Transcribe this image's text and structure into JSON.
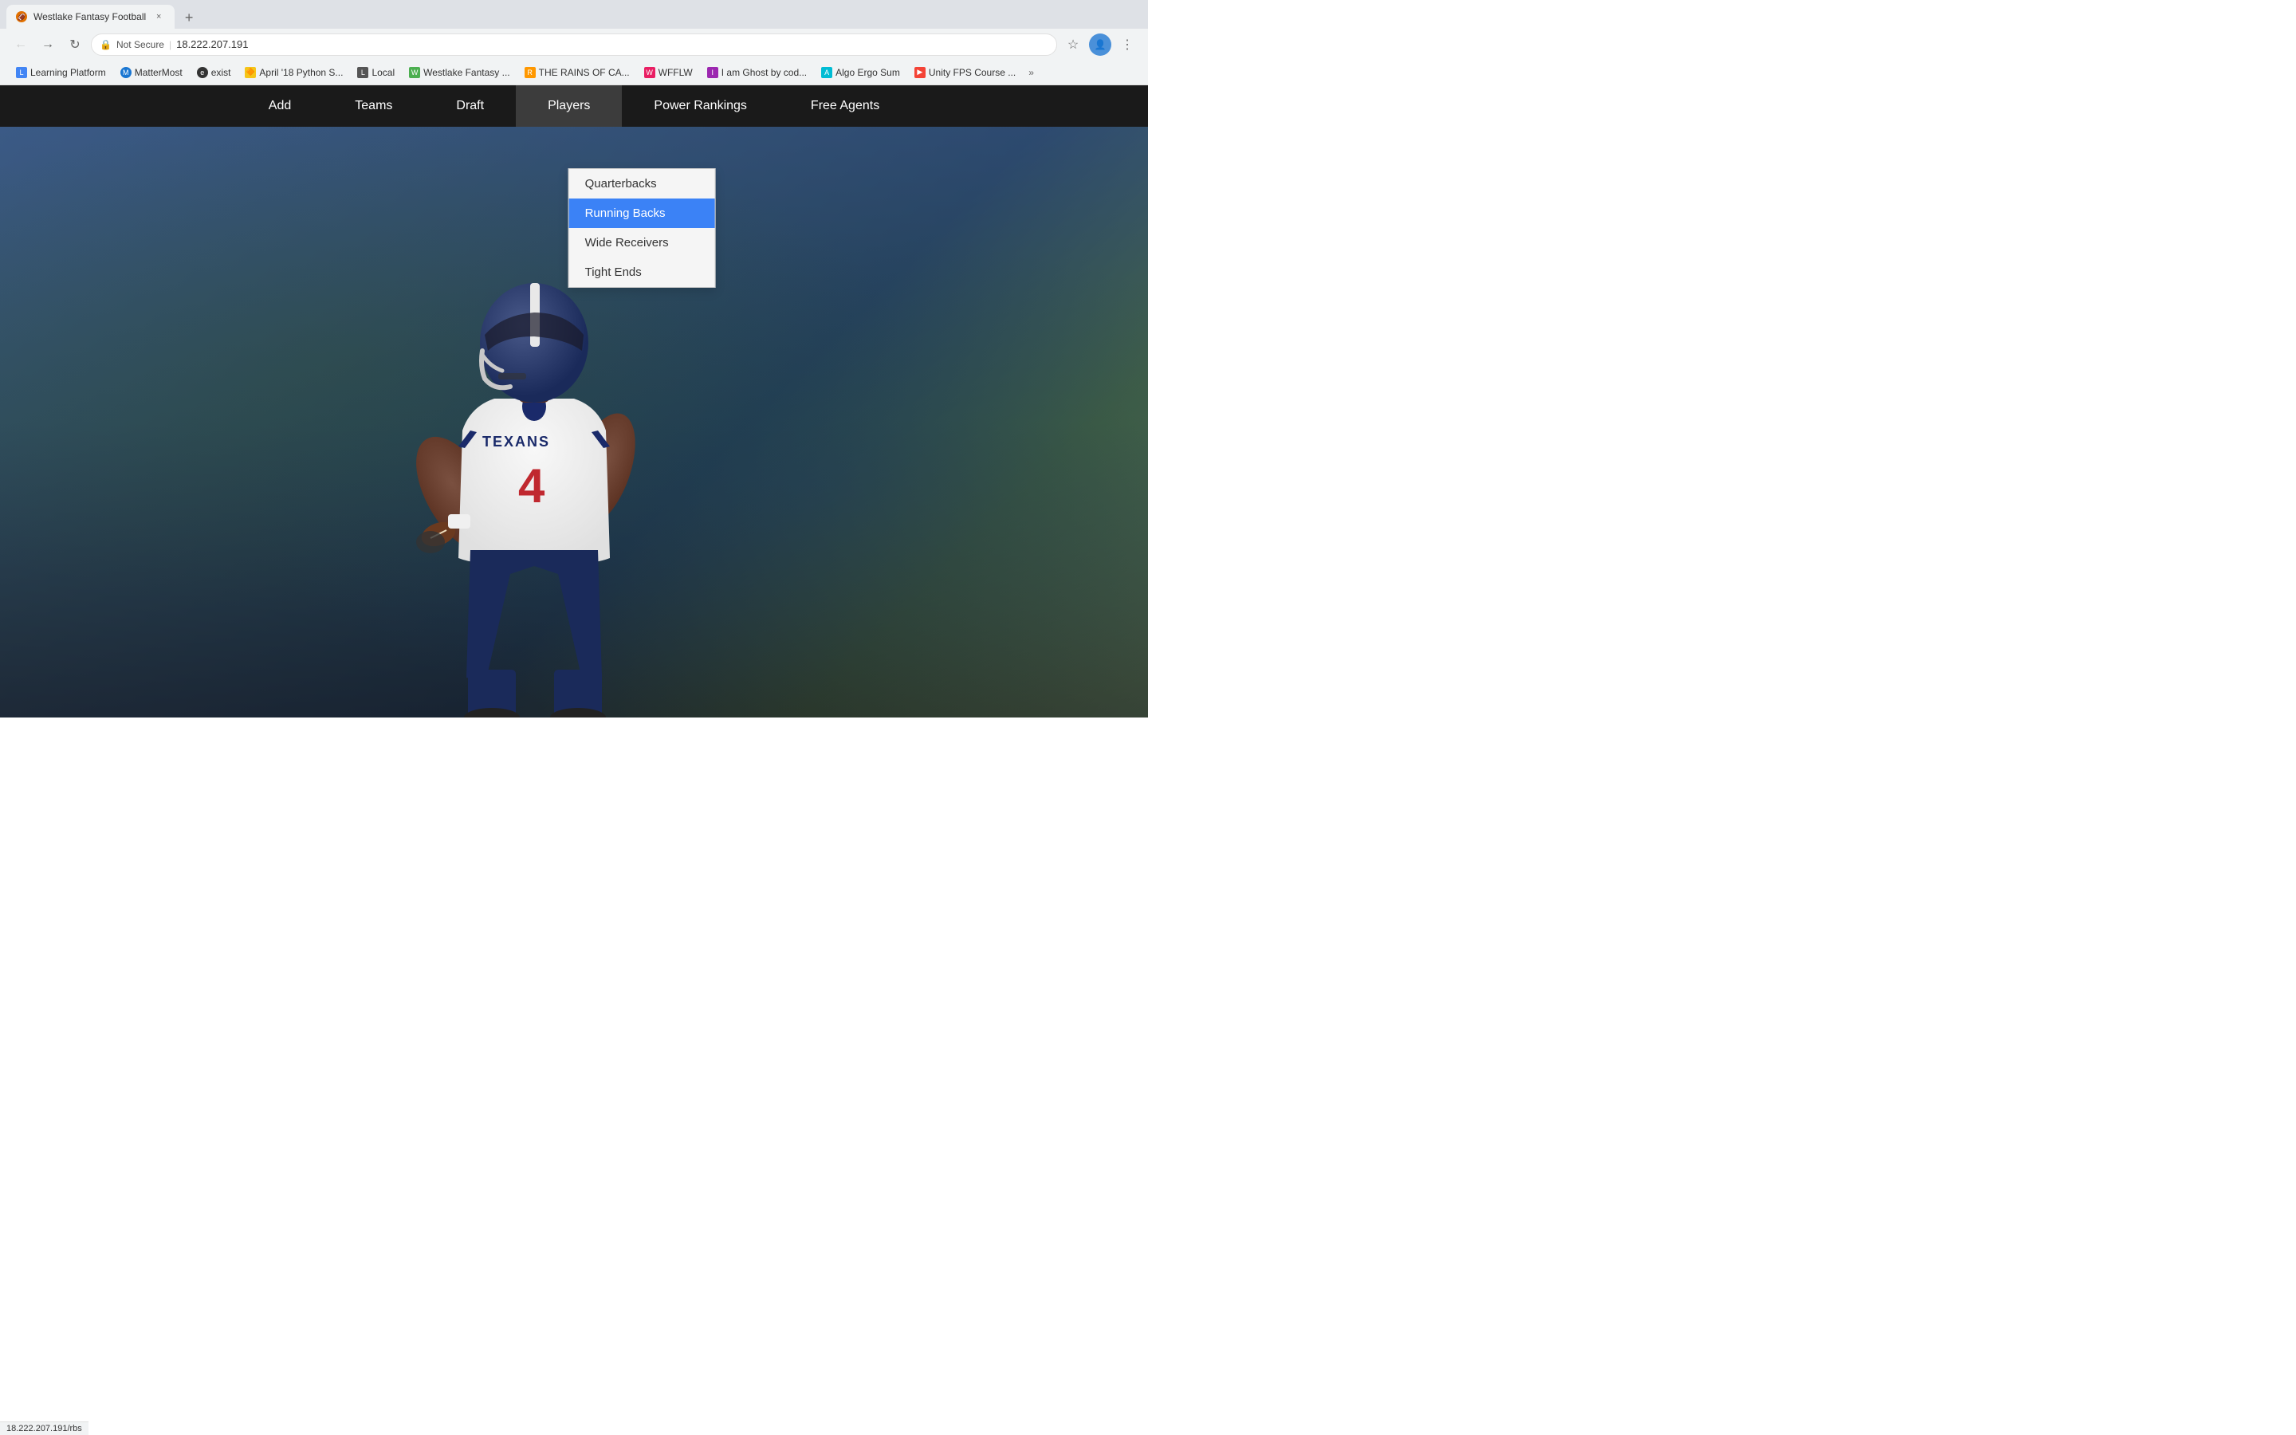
{
  "browser": {
    "tab": {
      "title": "Westlake Fantasy Football",
      "favicon": "🏈",
      "close_label": "×"
    },
    "new_tab_label": "+",
    "address_bar": {
      "not_secure_label": "Not Secure",
      "url": "18.222.207.191"
    },
    "bookmarks": [
      {
        "id": "learning-platform",
        "label": "Learning Platform",
        "favicon_color": "#4285f4"
      },
      {
        "id": "mattermost",
        "label": "MatterMost",
        "favicon_color": "#1976d2"
      },
      {
        "id": "exist",
        "label": "exist",
        "favicon_color": "#333"
      },
      {
        "id": "april-python",
        "label": "April '18 Python S...",
        "favicon_color": "#f5c518"
      },
      {
        "id": "local",
        "label": "Local",
        "favicon_color": "#555"
      },
      {
        "id": "westlake-fantasy",
        "label": "Westlake Fantasy ...",
        "favicon_color": "#4caf50"
      },
      {
        "id": "rains",
        "label": "THE RAINS OF CA...",
        "favicon_color": "#ff9800"
      },
      {
        "id": "wfflw",
        "label": "WFFLW",
        "favicon_color": "#e91e63"
      },
      {
        "id": "iam-ghost",
        "label": "I am Ghost by cod...",
        "favicon_color": "#9c27b0"
      },
      {
        "id": "algo-ergo",
        "label": "Algo Ergo Sum",
        "favicon_color": "#00bcd4"
      },
      {
        "id": "unity-fps",
        "label": "Unity FPS Course ...",
        "favicon_color": "#f44336"
      }
    ],
    "bookmarks_more": "»"
  },
  "nav": {
    "items": [
      {
        "id": "add",
        "label": "Add"
      },
      {
        "id": "teams",
        "label": "Teams"
      },
      {
        "id": "draft",
        "label": "Draft"
      },
      {
        "id": "players",
        "label": "Players"
      },
      {
        "id": "power-rankings",
        "label": "Power Rankings"
      },
      {
        "id": "free-agents",
        "label": "Free Agents"
      }
    ]
  },
  "players_dropdown": {
    "items": [
      {
        "id": "quarterbacks",
        "label": "Quarterbacks",
        "highlighted": false
      },
      {
        "id": "running-backs",
        "label": "Running Backs",
        "highlighted": true
      },
      {
        "id": "wide-receivers",
        "label": "Wide Receivers",
        "highlighted": false
      },
      {
        "id": "tight-ends",
        "label": "Tight Ends",
        "highlighted": false
      }
    ]
  },
  "status_bar": {
    "url": "18.222.207.191/rbs"
  }
}
